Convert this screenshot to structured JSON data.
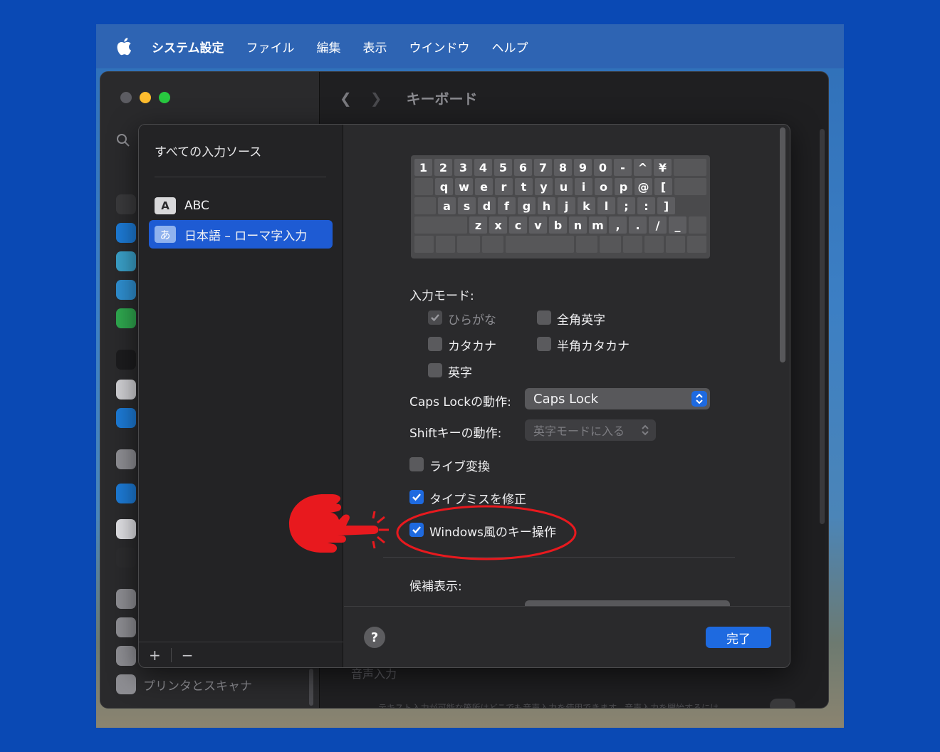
{
  "menubar": {
    "app_name": "システム設定",
    "items": [
      "ファイル",
      "編集",
      "表示",
      "ウインドウ",
      "ヘルプ"
    ]
  },
  "window": {
    "title": "キーボード",
    "sidebar_bottom_label": "プリンタとスキャナ",
    "bg_section_label": "音声入力",
    "bg_section_text": "テキスト入力が可能な箇所はどこでも音声入力を使用できます。音声入力を開始するには"
  },
  "sheet": {
    "sources_title": "すべての入力ソース",
    "sources": [
      {
        "badge": "A",
        "label": "ABC",
        "selected": false
      },
      {
        "badge": "あ",
        "label": "日本語 – ローマ字入力",
        "selected": true
      }
    ],
    "add_label": "+",
    "remove_label": "−",
    "keyboard_rows": [
      [
        "1",
        "2",
        "3",
        "4",
        "5",
        "6",
        "7",
        "8",
        "9",
        "0",
        "-",
        "^",
        "¥",
        ""
      ],
      [
        "q",
        "w",
        "e",
        "r",
        "t",
        "y",
        "u",
        "i",
        "o",
        "p",
        "@",
        "[",
        ""
      ],
      [
        "a",
        "s",
        "d",
        "f",
        "g",
        "h",
        "j",
        "k",
        "l",
        ";",
        ":",
        "]"
      ],
      [
        "z",
        "x",
        "c",
        "v",
        "b",
        "n",
        "m",
        ",",
        ".",
        "/",
        "_",
        ""
      ]
    ],
    "input_modes_label": "入力モード:",
    "input_modes": [
      {
        "label": "ひらがな",
        "checked": true,
        "disabled": true
      },
      {
        "label": "全角英字",
        "checked": false,
        "disabled": false
      },
      {
        "label": "カタカナ",
        "checked": false,
        "disabled": false
      },
      {
        "label": "半角カタカナ",
        "checked": false,
        "disabled": false
      },
      {
        "label": "英字",
        "checked": false,
        "disabled": false
      }
    ],
    "capslock_label": "Caps Lockの動作:",
    "capslock_value": "Caps Lock",
    "shift_label": "Shiftキーの動作:",
    "shift_value": "英字モードに入る",
    "live_conversion": {
      "label": "ライブ変換",
      "checked": false
    },
    "typo_fix": {
      "label": "タイプミスを修正",
      "checked": true
    },
    "windows_keys": {
      "label": "Windows風のキー操作",
      "checked": true
    },
    "candidates_label": "候補表示:",
    "help_label": "?",
    "done_label": "完了"
  },
  "colors": {
    "accent": "#1e6ae0",
    "annotation": "#e8191e"
  }
}
